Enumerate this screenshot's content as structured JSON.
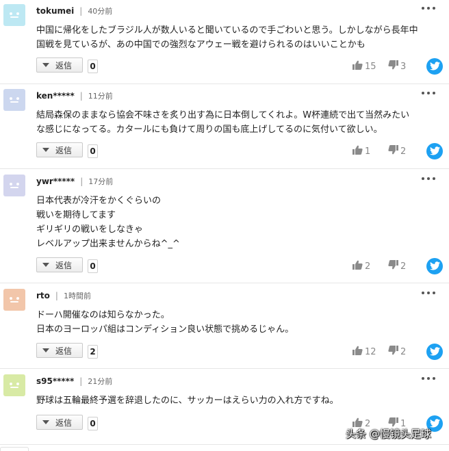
{
  "reply_label": "返信",
  "colors": {
    "twitter": "#1da1f2"
  },
  "icons": {
    "more": "more-dots-icon",
    "like": "thumbs-up-icon",
    "dislike": "thumbs-down-icon",
    "share": "twitter-bird-icon",
    "dropdown": "caret-down-icon"
  },
  "comments": [
    {
      "user": "tokumei",
      "time": "40分前",
      "avatar_color": "#bde8f3",
      "lines": [
        "中国に帰化をしたブラジル人が数人いると聞いているので手ごわいと思う。しかしながら長年中",
        "国戦を見ているが、あの中国での強烈なアウェー戦を避けられるのはいいことかも"
      ],
      "replies": "0",
      "likes": "15",
      "dislikes": "3"
    },
    {
      "user": "ken*****",
      "time": "11分前",
      "avatar_color": "#ccd7ef",
      "lines": [
        "結局森保のままなら協会不味さを炙り出す為に日本倒してくれよ。W杯連続で出て当然みたい",
        "な感じになってる。カタールにも負けて周りの国も底上げしてるのに気付いて欲しい。"
      ],
      "replies": "0",
      "likes": "1",
      "dislikes": "2"
    },
    {
      "user": "ywr*****",
      "time": "17分前",
      "avatar_color": "#d3d5ee",
      "lines": [
        "日本代表が冷汗をかくぐらいの",
        "戦いを期待してます",
        "ギリギリの戦いをしなきゃ",
        "レベルアップ出来ませんからね^_^"
      ],
      "replies": "0",
      "likes": "2",
      "dislikes": "2"
    },
    {
      "user": "rto",
      "time": "1時間前",
      "avatar_color": "#f2c6aa",
      "lines": [
        "ドーハ開催なのは知らなかった。",
        "日本のヨーロッパ組はコンディション良い状態で挑めるじゃん。"
      ],
      "replies": "2",
      "likes": "12",
      "dislikes": "2"
    },
    {
      "user": "s95*****",
      "time": "21分前",
      "avatar_color": "#d8eaa5",
      "lines": [
        "野球は五輪最終予選を辞退したのに、サッカーはえらい力の入れ方ですね。"
      ],
      "replies": "0",
      "likes": "2",
      "dislikes": "1"
    }
  ],
  "watermark": "头条 @慢镜头足球"
}
